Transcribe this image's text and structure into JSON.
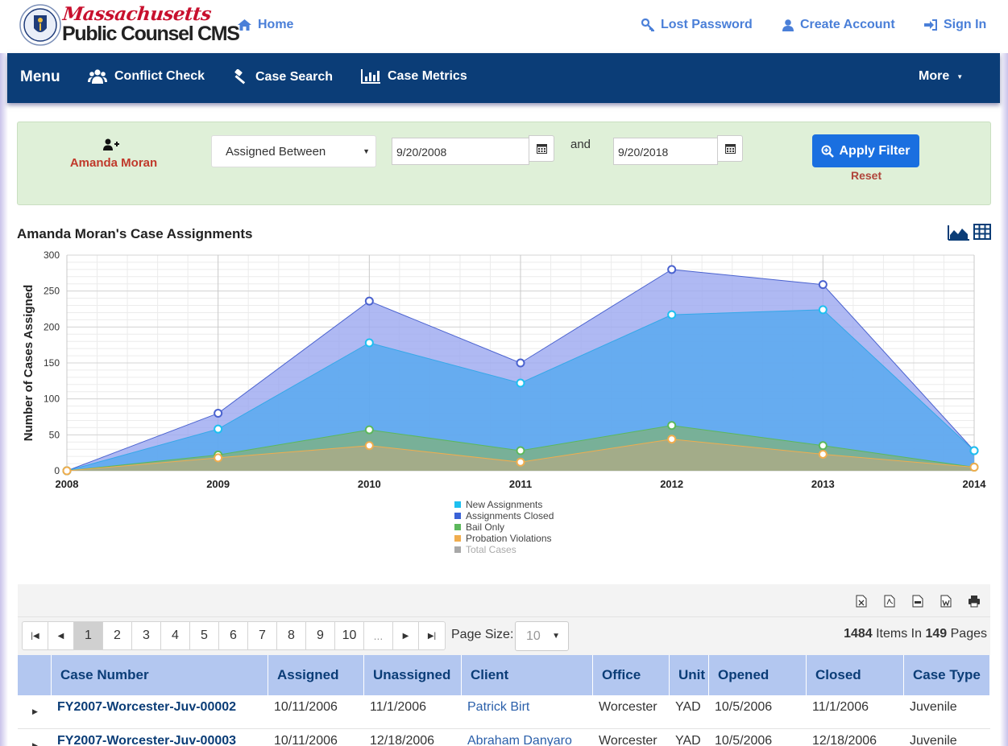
{
  "header": {
    "brand_line1": "Massachusetts",
    "brand_line2": "Public Counsel CMS",
    "home": "Home",
    "lost_password": "Lost Password",
    "create_account": "Create Account",
    "sign_in": "Sign In",
    "accent_color": "#4a7fd8",
    "brand_red": "#c8102e"
  },
  "nav": {
    "menu": "Menu",
    "conflict_check": "Conflict Check",
    "case_search": "Case Search",
    "case_metrics": "Case Metrics",
    "more": "More",
    "background_color": "#0b3d77"
  },
  "filter": {
    "user_name": "Amanda Moran",
    "mode": "Assigned Between",
    "start_date": "9/20/2008",
    "and_label": "and",
    "end_date": "9/20/2018",
    "apply_label": "Apply Filter",
    "reset_label": "Reset"
  },
  "chart_title": "Amanda Moran's Case Assignments",
  "chart_data": {
    "type": "area",
    "x": [
      2008,
      2009,
      2010,
      2011,
      2012,
      2013,
      2014
    ],
    "x_tick_labels": [
      "2008",
      "2009",
      "2010",
      "2011",
      "2012",
      "2013",
      "2014"
    ],
    "y_ticks": [
      0,
      50,
      100,
      150,
      200,
      250,
      300
    ],
    "ylim": [
      0,
      300
    ],
    "ylabel": "Number of Cases Assigned",
    "xlabel": "",
    "grid": true,
    "legend_position": "bottom",
    "series": [
      {
        "name": "New Assignments",
        "values": [
          0,
          58,
          178,
          122,
          217,
          224,
          28
        ],
        "color": "#1ec0f0"
      },
      {
        "name": "Assignments Closed",
        "values": [
          0,
          80,
          236,
          150,
          280,
          259,
          28
        ],
        "color": "#3a62d6"
      },
      {
        "name": "Bail Only",
        "values": [
          0,
          22,
          57,
          28,
          63,
          35,
          5
        ],
        "color": "#5cb85c"
      },
      {
        "name": "Probation Violations",
        "values": [
          0,
          18,
          35,
          12,
          44,
          23,
          5
        ],
        "color": "#f0ad4e"
      },
      {
        "name": "Total Cases",
        "values": [],
        "color": "#a8a8a8",
        "hidden": true
      }
    ]
  },
  "pager": {
    "pages": [
      "1",
      "2",
      "3",
      "4",
      "5",
      "6",
      "7",
      "8",
      "9",
      "10",
      "..."
    ],
    "page_size_label": "Page Size:",
    "page_size": "10",
    "items_count": "1484",
    "items_mid": "Items In",
    "pages_count": "149",
    "pages_label": "Pages"
  },
  "table": {
    "columns": [
      "Case Number",
      "Assigned",
      "Unassigned",
      "Client",
      "Office",
      "Unit",
      "Opened",
      "Closed",
      "Case Type"
    ],
    "rows": [
      {
        "case_number": "FY2007-Worcester-Juv-00002",
        "assigned": "10/11/2006",
        "unassigned": "11/1/2006",
        "client": "Patrick Birt",
        "office": "Worcester",
        "unit": "YAD",
        "opened": "10/5/2006",
        "closed": "11/1/2006",
        "case_type": "Juvenile"
      },
      {
        "case_number": "FY2007-Worcester-Juv-00003",
        "assigned": "10/11/2006",
        "unassigned": "12/18/2006",
        "client": "Abraham Danyaro",
        "office": "Worcester",
        "unit": "YAD",
        "opened": "10/5/2006",
        "closed": "12/18/2006",
        "case_type": "Juvenile"
      }
    ]
  }
}
